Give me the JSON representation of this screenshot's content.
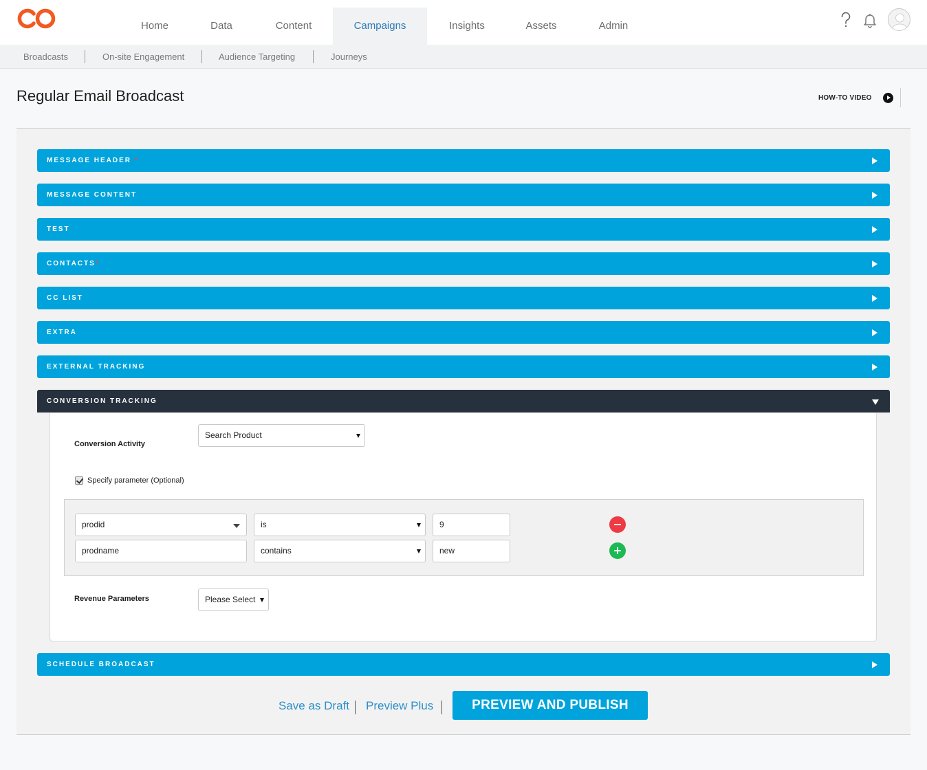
{
  "colors": {
    "accent": "#00a3dc",
    "dark_header": "#27313e",
    "logo": "#f15a22",
    "remove": "#ee3a44",
    "add": "#1db954"
  },
  "nav": {
    "items": [
      {
        "label": "Home",
        "active": false
      },
      {
        "label": "Data",
        "active": false
      },
      {
        "label": "Content",
        "active": false
      },
      {
        "label": "Campaigns",
        "active": true
      },
      {
        "label": "Insights",
        "active": false
      },
      {
        "label": "Assets",
        "active": false
      },
      {
        "label": "Admin",
        "active": false
      }
    ],
    "icons": [
      "help-icon",
      "bell-icon",
      "user-avatar-icon"
    ]
  },
  "subnav": {
    "items": [
      "Broadcasts",
      "On-site Engagement",
      "Audience Targeting",
      "Journeys"
    ]
  },
  "page": {
    "title": "Regular Email Broadcast",
    "howto_label": "HOW-TO VIDEO"
  },
  "sections": [
    {
      "label": "MESSAGE HEADER",
      "required": "*",
      "expanded": false
    },
    {
      "label": "MESSAGE CONTENT",
      "required": "",
      "expanded": false
    },
    {
      "label": "TEST",
      "required": "",
      "expanded": false
    },
    {
      "label": "CONTACTS",
      "required": "*",
      "expanded": false
    },
    {
      "label": "CC LIST",
      "required": "",
      "expanded": false
    },
    {
      "label": "EXTRA",
      "required": "",
      "expanded": false
    },
    {
      "label": "EXTERNAL TRACKING",
      "required": "",
      "expanded": false
    },
    {
      "label": "CONVERSION TRACKING",
      "required": "",
      "expanded": true
    },
    {
      "label": "SCHEDULE BROADCAST",
      "required": "",
      "expanded": false
    }
  ],
  "conversion": {
    "activity_label": "Conversion Activity",
    "activity_value": "Search Product",
    "specify_param_label": "Specify parameter (Optional)",
    "specify_param_checked": true,
    "params": [
      {
        "name": "prodid",
        "operator": "is",
        "value": "9",
        "action": "remove"
      },
      {
        "name": "prodname",
        "operator": "contains",
        "value": "new",
        "action": "add"
      }
    ],
    "revenue_label": "Revenue Parameters",
    "revenue_value": "Please Select"
  },
  "actions": {
    "save_draft": "Save as Draft",
    "preview_plus": "Preview Plus",
    "publish": "PREVIEW AND PUBLISH"
  }
}
